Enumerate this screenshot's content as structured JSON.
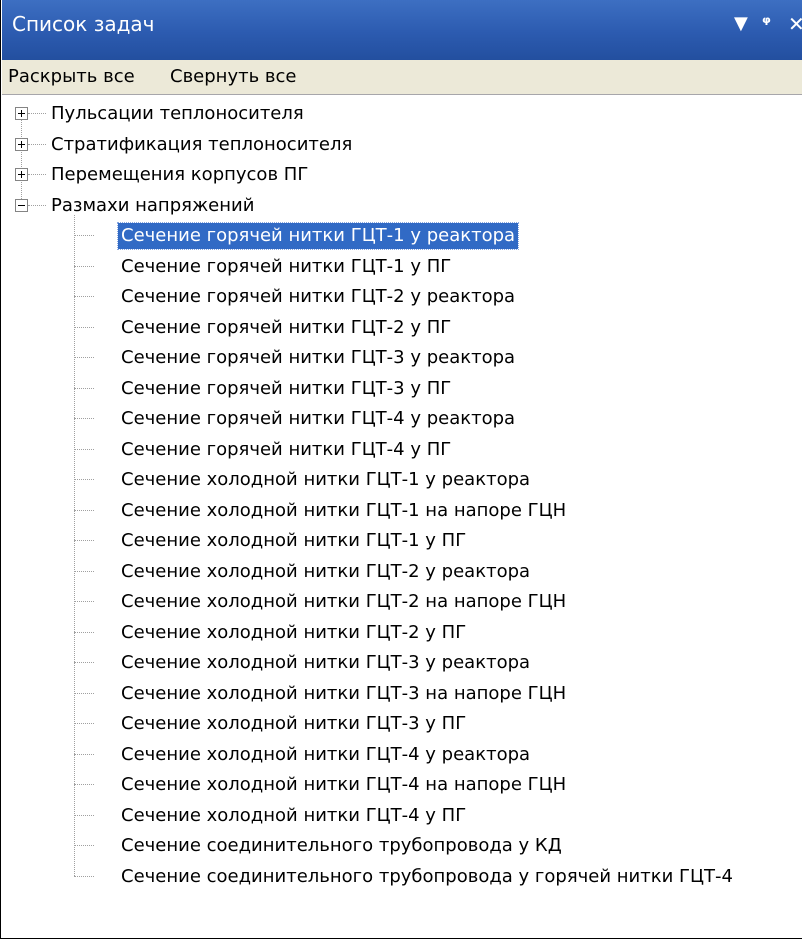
{
  "panel": {
    "title": "Список задач",
    "buttons": {
      "dropdown": "▼",
      "pin": "ᵠ",
      "close": "✕"
    }
  },
  "toolbar": {
    "expand_all": "Раскрыть все",
    "collapse_all": "Свернуть все"
  },
  "tree": {
    "groups": [
      {
        "label": "Пульсации теплоносителя",
        "expanded": false
      },
      {
        "label": "Стратификация  теплоносителя",
        "expanded": false
      },
      {
        "label": "Перемещения корпусов ПГ",
        "expanded": false
      },
      {
        "label": "Размахи напряжений",
        "expanded": true
      }
    ],
    "children": [
      {
        "label": "Сечение горячей нитки ГЦТ-1 у реактора",
        "selected": true
      },
      {
        "label": "Сечение горячей нитки ГЦТ-1 у ПГ",
        "selected": false
      },
      {
        "label": "Сечение горячей нитки ГЦТ-2 у реактора",
        "selected": false
      },
      {
        "label": "Сечение горячей нитки ГЦТ-2 у ПГ",
        "selected": false
      },
      {
        "label": "Сечение горячей нитки ГЦТ-3 у реактора",
        "selected": false
      },
      {
        "label": "Сечение горячей нитки ГЦТ-3 у ПГ",
        "selected": false
      },
      {
        "label": "Сечение горячей нитки ГЦТ-4 у реактора",
        "selected": false
      },
      {
        "label": "Сечение горячей нитки ГЦТ-4 у ПГ",
        "selected": false
      },
      {
        "label": "Сечение холодной нитки ГЦТ-1 у реактора",
        "selected": false
      },
      {
        "label": "Сечение холодной нитки ГЦТ-1 на напоре ГЦН",
        "selected": false
      },
      {
        "label": "Сечение холодной нитки ГЦТ-1 у ПГ",
        "selected": false
      },
      {
        "label": "Сечение холодной нитки ГЦТ-2 у реактора",
        "selected": false
      },
      {
        "label": "Сечение холодной нитки ГЦТ-2 на напоре ГЦН",
        "selected": false
      },
      {
        "label": "Сечение холодной нитки ГЦТ-2 у ПГ",
        "selected": false
      },
      {
        "label": "Сечение холодной нитки ГЦТ-3 у реактора",
        "selected": false
      },
      {
        "label": "Сечение холодной нитки ГЦТ-3 на напоре ГЦН",
        "selected": false
      },
      {
        "label": "Сечение холодной нитки ГЦТ-3 у ПГ",
        "selected": false
      },
      {
        "label": "Сечение холодной нитки ГЦТ-4 у реактора",
        "selected": false
      },
      {
        "label": "Сечение холодной нитки ГЦТ-4 на напоре ГЦН",
        "selected": false
      },
      {
        "label": "Сечение холодной нитки ГЦТ-4 у ПГ",
        "selected": false
      },
      {
        "label": "Сечение соединительного трубопровода у КД",
        "selected": false
      },
      {
        "label": "Сечение соединительного трубопровода у горячей нитки ГЦТ-4",
        "selected": false
      }
    ]
  },
  "colors": {
    "title_bar": "#2c5bb0",
    "selection": "#316ac5",
    "toolbar_bg": "#ece9d8"
  }
}
